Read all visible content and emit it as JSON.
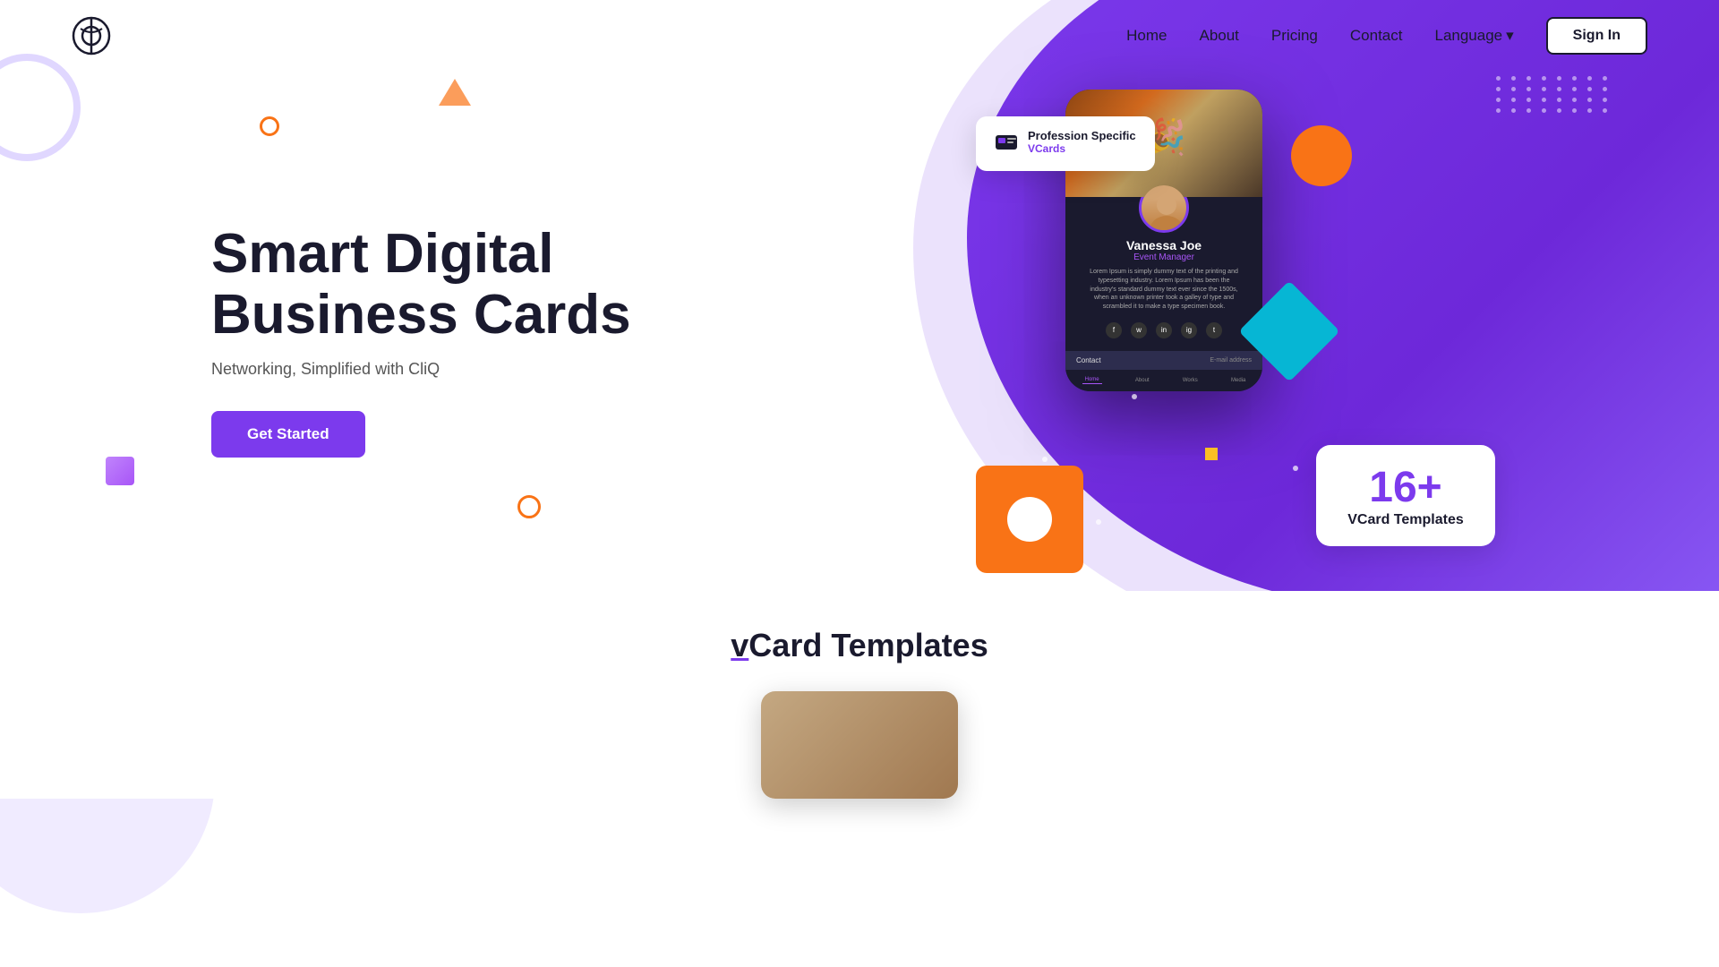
{
  "site": {
    "logo_alt": "CliQ Logo"
  },
  "nav": {
    "links": [
      {
        "label": "Home",
        "id": "home"
      },
      {
        "label": "About",
        "id": "about"
      },
      {
        "label": "Pricing",
        "id": "pricing"
      },
      {
        "label": "Contact",
        "id": "contact"
      }
    ],
    "language": "Language",
    "sign_in": "Sign In"
  },
  "hero": {
    "title": "Smart Digital Business Cards",
    "subtitle": "Networking, Simplified with CliQ",
    "cta": "Get Started"
  },
  "badge_profession": {
    "title": "Profession Specific",
    "sub": "VCards"
  },
  "badge_templates": {
    "number": "16+",
    "label": "VCard Templates"
  },
  "phone_card": {
    "name": "Vanessa Joe",
    "role": "Event Manager",
    "desc": "Lorem Ipsum is simply dummy text of the printing and typesetting industry. Lorem Ipsum has been the industry's standard dummy text ever since the 1500s, when an unknown printer took a galley of type and scrambled it to make a type specimen book.",
    "contact_label": "Contact",
    "tabs": [
      "Home",
      "About",
      "Works",
      "Media"
    ]
  },
  "section": {
    "title_prefix": "v",
    "title_main": "Card Templates"
  },
  "decorations": {
    "dots_count": 32
  }
}
